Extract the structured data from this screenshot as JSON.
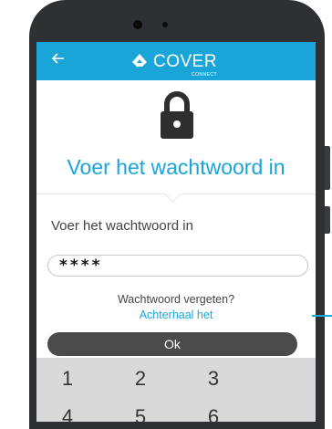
{
  "app": {
    "logo_text": "COVER",
    "logo_subtext": "CONNECT"
  },
  "screen": {
    "heading": "Voer het wachtwoord in",
    "field_label": "Voer het wachtwoord in",
    "password_value": "****",
    "forgot_text": "Wachtwoord vergeten?",
    "recover_link": "Achterhaal het",
    "ok_label": "Ok"
  },
  "keypad": {
    "row1": [
      "1",
      "2",
      "3"
    ],
    "row2": [
      "4",
      "5",
      "6"
    ]
  },
  "icons": {
    "back": "arrow-left-icon",
    "lock": "lock-icon",
    "logo": "cover-logo-icon"
  },
  "colors": {
    "accent": "#1aa5d8",
    "appbar": "#1aa5d8",
    "button": "#4b4b4b",
    "phone_body": "#2f3033",
    "keypad_bg": "#d9d9d9"
  }
}
